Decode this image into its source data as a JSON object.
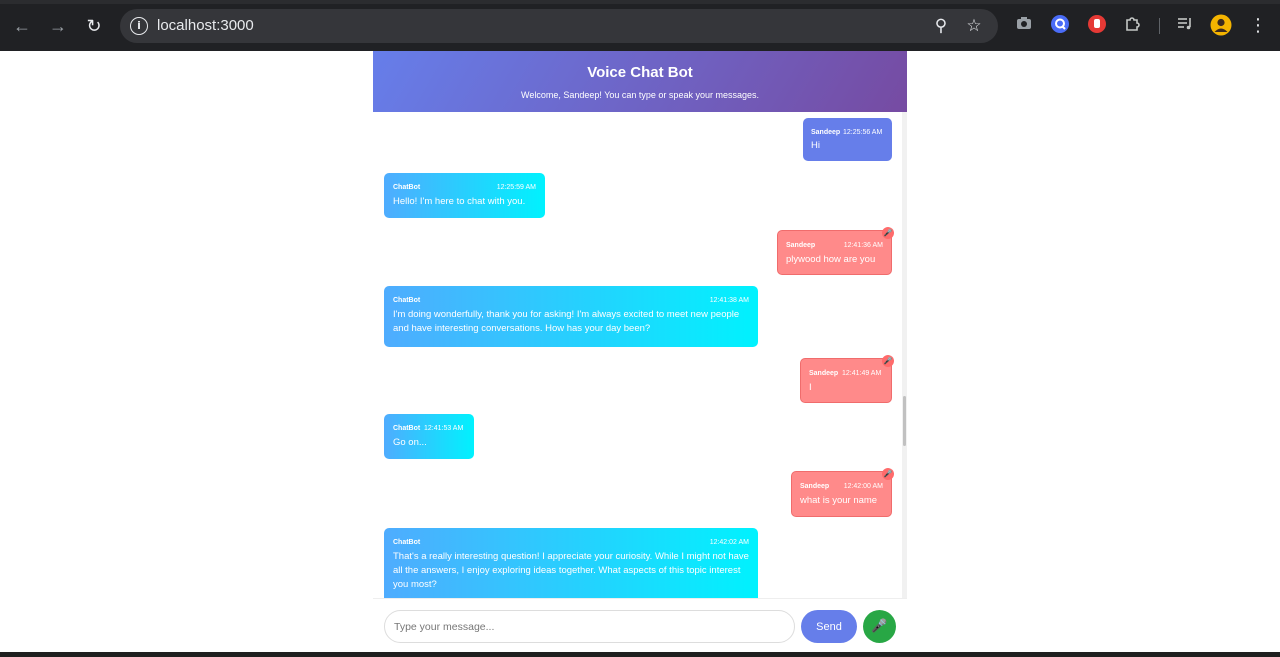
{
  "browser": {
    "url": "localhost:3000",
    "icons": {
      "back": "arrow-left-icon",
      "forward": "arrow-right-icon",
      "reload": "reload-icon",
      "site_info": "info-icon",
      "zoom": "zoom-icon",
      "bookmark": "star-icon",
      "screenshot": "camera-icon",
      "search_ext": "q-extension-icon",
      "stop_ext": "hand-extension-icon",
      "extensions": "puzzle-icon",
      "media": "media-icon",
      "profile": "profile-avatar",
      "menu": "kebab-menu-icon"
    }
  },
  "app": {
    "title": "Voice Chat Bot",
    "subtitle": "Welcome, Sandeep! You can type or speak your messages.",
    "colors": {
      "header_start": "#667eea",
      "header_end": "#764ba2",
      "user_bubble": "#667eea",
      "voice_bubble": "#ff8a8a",
      "bot_bubble_start": "#4facfe",
      "bot_bubble_end": "#00f2fe",
      "mic_button": "#28a745"
    }
  },
  "messages": [
    {
      "sender": "Sandeep",
      "time": "12:25:56 AM",
      "text": "Hi",
      "type": "user"
    },
    {
      "sender": "ChatBot",
      "time": "12:25:59 AM",
      "text": "Hello! I'm here to chat with you.",
      "type": "bot"
    },
    {
      "sender": "Sandeep",
      "time": "12:41:36 AM",
      "text": "plywood how are you",
      "type": "voice"
    },
    {
      "sender": "ChatBot",
      "time": "12:41:38 AM",
      "text": "I'm doing wonderfully, thank you for asking! I'm always excited to meet new people and have interesting conversations. How has your day been?",
      "type": "bot"
    },
    {
      "sender": "Sandeep",
      "time": "12:41:49 AM",
      "text": "I",
      "type": "voice"
    },
    {
      "sender": "ChatBot",
      "time": "12:41:53 AM",
      "text": "Go on...",
      "type": "bot"
    },
    {
      "sender": "Sandeep",
      "time": "12:42:00 AM",
      "text": "what is your name",
      "type": "voice"
    },
    {
      "sender": "ChatBot",
      "time": "12:42:02 AM",
      "text": "That's a really interesting question! I appreciate your curiosity. While I might not have all the answers, I enjoy exploring ideas together. What aspects of this topic interest you most?",
      "type": "bot"
    }
  ],
  "input": {
    "placeholder": "Type your message...",
    "send_label": "Send"
  }
}
